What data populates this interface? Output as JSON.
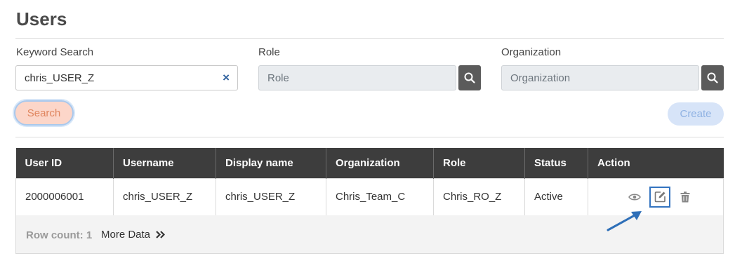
{
  "page": {
    "title": "Users"
  },
  "filters": {
    "keyword": {
      "label": "Keyword Search",
      "value": "chris_USER_Z",
      "clear_glyph": "×"
    },
    "role": {
      "label": "Role",
      "placeholder": "Role"
    },
    "organization": {
      "label": "Organization",
      "placeholder": "Organization"
    }
  },
  "buttons": {
    "search": "Search",
    "create": "Create"
  },
  "table": {
    "columns": [
      "User ID",
      "Username",
      "Display name",
      "Organization",
      "Role",
      "Status",
      "Action"
    ],
    "rows": [
      {
        "user_id": "2000006001",
        "username": "chris_USER_Z",
        "display_name": "chris_USER_Z",
        "organization": "Chris_Team_C",
        "role": "Chris_RO_Z",
        "status": "Active"
      }
    ]
  },
  "footer": {
    "row_count": "Row count: 1",
    "more_data": "More Data"
  },
  "icons": [
    "search-icon",
    "eye-icon",
    "edit-icon",
    "trash-icon",
    "double-chevron-right-icon",
    "arrow-annotation"
  ],
  "colors": {
    "header_bg": "#3d3d3d",
    "status_active": "#4a8ad4",
    "search_btn_bg": "#fcd6c9",
    "create_btn_bg": "#d7e4f8",
    "highlight": "#3474c0"
  }
}
